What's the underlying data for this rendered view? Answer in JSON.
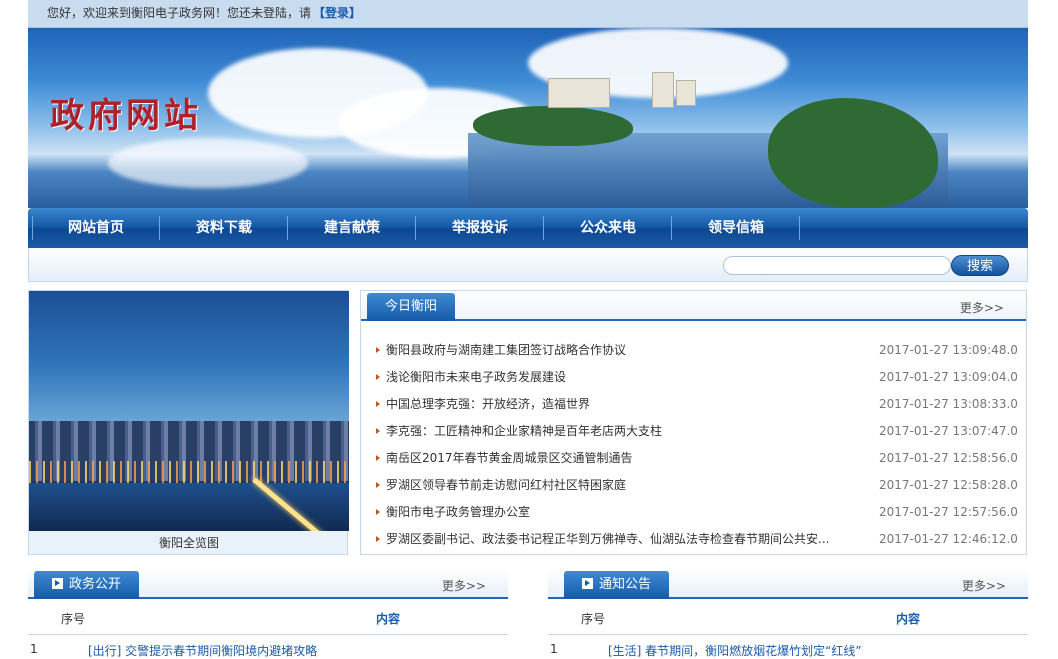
{
  "topbar": {
    "welcome": "您好，欢迎来到衡阳电子政务网！您还未登陆，请",
    "login_label": "【登录】"
  },
  "banner": {
    "logo_text": "政府网站"
  },
  "nav": {
    "items": [
      "网站首页",
      "资料下载",
      "建言献策",
      "举报投诉",
      "公众来电",
      "领导信箱"
    ]
  },
  "search": {
    "value": "",
    "button_label": "搜索"
  },
  "photo": {
    "caption": "衡阳全览图"
  },
  "today": {
    "title": "今日衡阳",
    "more": "更多>>",
    "items": [
      {
        "title": "衡阳县政府与湖南建工集团签订战略合作协议",
        "date": "2017-01-27 13:09:48.0"
      },
      {
        "title": "浅论衡阳市未来电子政务发展建设",
        "date": "2017-01-27 13:09:04.0"
      },
      {
        "title": "中国总理李克强：开放经济，造福世界",
        "date": "2017-01-27 13:08:33.0"
      },
      {
        "title": "李克强：工匠精神和企业家精神是百年老店两大支柱",
        "date": "2017-01-27 13:07:47.0"
      },
      {
        "title": "南岳区2017年春节黄金周城景区交通管制通告",
        "date": "2017-01-27 12:58:56.0"
      },
      {
        "title": "罗湖区领导春节前走访慰问红村社区特困家庭",
        "date": "2017-01-27 12:58:28.0"
      },
      {
        "title": "衡阳市电子政务管理办公室",
        "date": "2017-01-27 12:57:56.0"
      },
      {
        "title": "罗湖区委副书记、政法委书记程正华到万佛禅寺、仙湖弘法寺检查春节期间公共安...",
        "date": "2017-01-27 12:46:12.0"
      }
    ]
  },
  "gov": {
    "title": "政务公开",
    "more": "更多>>",
    "col_no": "序号",
    "col_content": "内容",
    "rows": [
      {
        "no": "1",
        "text": "[出行] 交警提示春节期间衡阳境内避堵攻略"
      }
    ]
  },
  "notice": {
    "title": "通知公告",
    "more": "更多>>",
    "col_no": "序号",
    "col_content": "内容",
    "rows": [
      {
        "no": "1",
        "text": "[生活] 春节期间，衡阳燃放烟花爆竹划定“红线”"
      }
    ]
  }
}
